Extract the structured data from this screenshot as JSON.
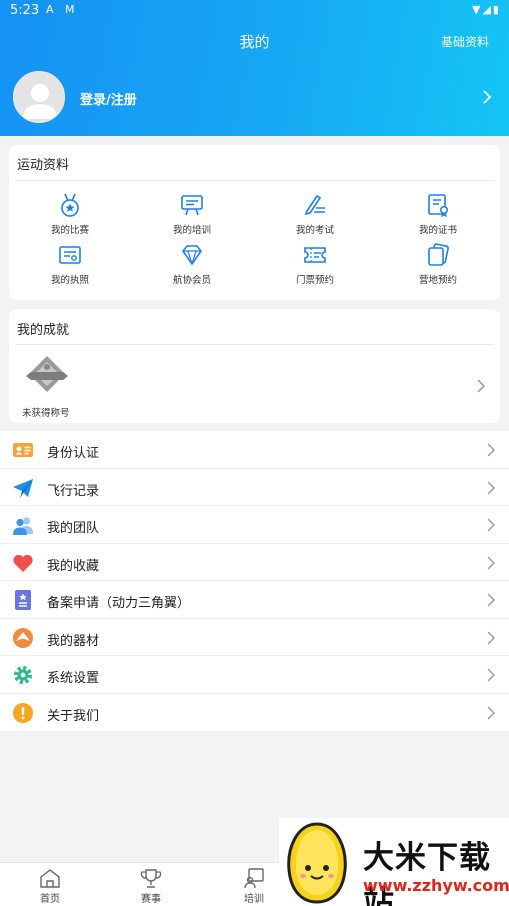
{
  "status_bar": {
    "time": "5:23",
    "left_icons": "A M",
    "right_icons": "▼◢▮"
  },
  "header": {
    "title": "我的",
    "right_link": "基础资料",
    "login_text": "登录/注册"
  },
  "sports_card": {
    "title": "运动资料",
    "items": [
      {
        "label": "我的比赛",
        "icon": "medal-icon"
      },
      {
        "label": "我的培训",
        "icon": "easel-icon"
      },
      {
        "label": "我的考试",
        "icon": "exam-pen-icon"
      },
      {
        "label": "我的证书",
        "icon": "certificate-icon"
      },
      {
        "label": "我的执照",
        "icon": "license-icon"
      },
      {
        "label": "航协会员",
        "icon": "diamond-icon"
      },
      {
        "label": "门票预约",
        "icon": "ticket-icon"
      },
      {
        "label": "营地预约",
        "icon": "camp-cards-icon"
      }
    ]
  },
  "achievement_card": {
    "title": "我的成就",
    "badge_label": "未获得称号"
  },
  "menu": {
    "items": [
      {
        "label": "身份认证",
        "icon": "id-card-icon",
        "color": "#f6a33a"
      },
      {
        "label": "飞行记录",
        "icon": "paper-plane-icon",
        "color": "#1e8fe8"
      },
      {
        "label": "我的团队",
        "icon": "team-icon",
        "color": "#4aa3f0"
      },
      {
        "label": "我的收藏",
        "icon": "heart-icon",
        "color": "#f0504a"
      },
      {
        "label": "备案申请（动力三角翼）",
        "icon": "filing-icon",
        "color": "#6a74e6"
      },
      {
        "label": "我的器材",
        "icon": "equipment-icon",
        "color": "#f08a3c"
      },
      {
        "label": "系统设置",
        "icon": "gear-icon",
        "color": "#2bb88e"
      },
      {
        "label": "关于我们",
        "icon": "info-icon",
        "color": "#f5a623"
      }
    ]
  },
  "tabbar": {
    "items": [
      {
        "label": "首页",
        "icon": "home-icon"
      },
      {
        "label": "赛事",
        "icon": "trophy-icon"
      },
      {
        "label": "培训",
        "icon": "training-icon"
      }
    ]
  },
  "watermark": {
    "title": "大米下载站",
    "url": "www.zzhyw.com"
  },
  "colors": {
    "header_start": "#1592f5",
    "header_end": "#14c6f6",
    "icon_blue": "#1e7ee8",
    "background": "#f2f3f5"
  }
}
